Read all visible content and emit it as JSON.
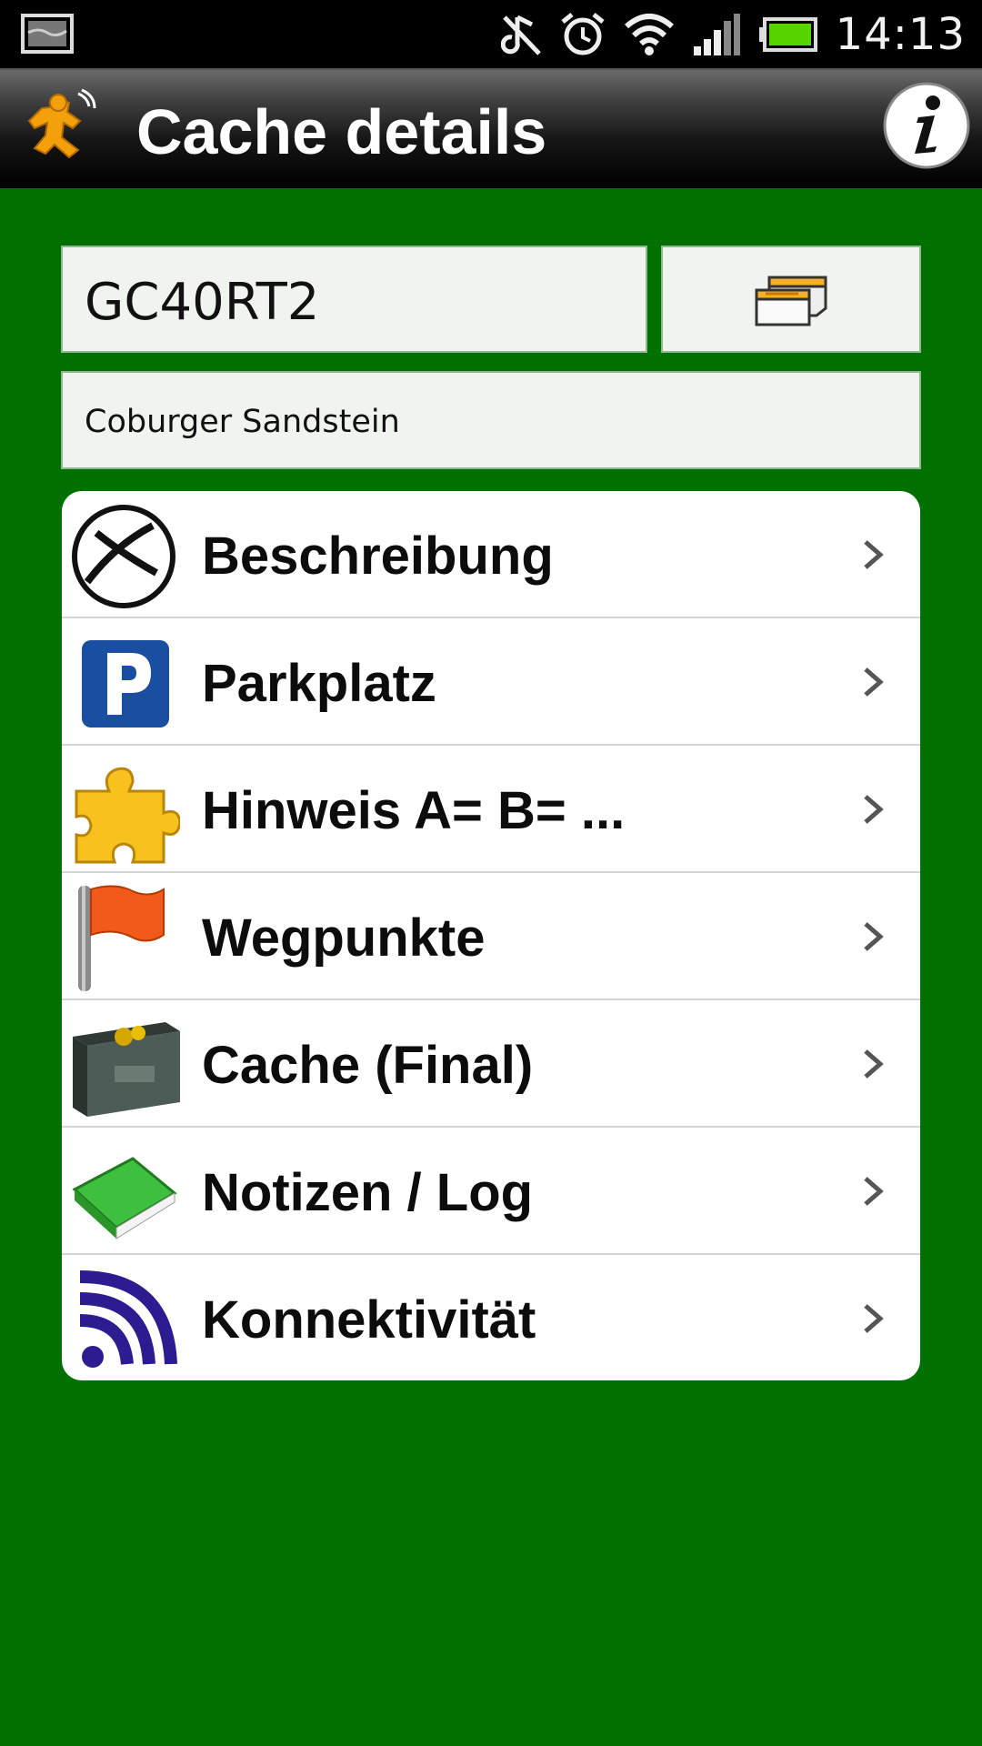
{
  "status_bar": {
    "time": "14:13",
    "icons": [
      "gallery-icon",
      "mute-icon",
      "alarm-icon",
      "wifi-icon",
      "signal-icon",
      "battery-icon"
    ]
  },
  "header": {
    "title": "Cache details",
    "app_icon": "app-logo-icon",
    "info_icon": "info-icon"
  },
  "cache": {
    "code": "GC40RT2",
    "name": "Coburger Sandstein",
    "button_icon": "cache-box-icon"
  },
  "menu": {
    "items": [
      {
        "label": "Beschreibung",
        "icon": "geocaching-logo-icon"
      },
      {
        "label": "Parkplatz",
        "icon": "parking-icon"
      },
      {
        "label": "Hinweis A= B= ...",
        "icon": "puzzle-icon"
      },
      {
        "label": "Wegpunkte",
        "icon": "flag-icon"
      },
      {
        "label": "Cache (Final)",
        "icon": "ammo-box-icon"
      },
      {
        "label": "Notizen / Log",
        "icon": "book-icon"
      },
      {
        "label": "Konnektivität",
        "icon": "connectivity-icon"
      }
    ]
  },
  "colors": {
    "background": "#007000",
    "field_bg": "#f0f4ee",
    "accent_orange": "#f4a00a"
  }
}
